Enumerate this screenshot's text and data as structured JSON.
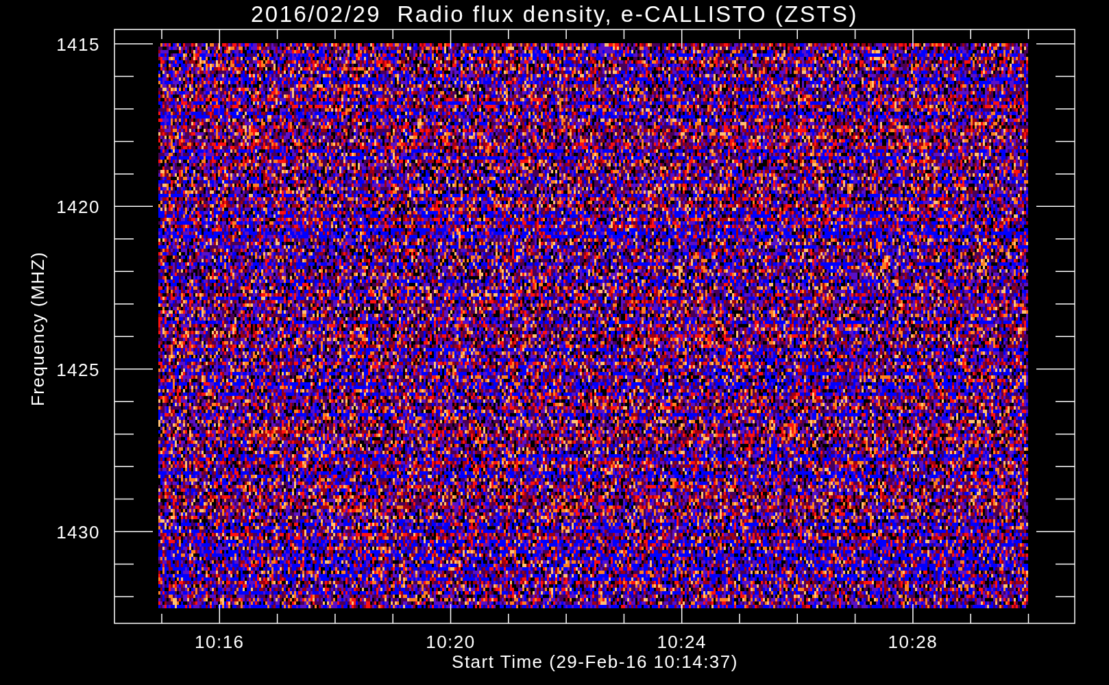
{
  "title": "2016/02/29  Radio flux density, e-CALLISTO (ZSTS)",
  "y_axis": {
    "label": "Frequency (MHZ)",
    "ticks": [
      "1415",
      "1420",
      "1425",
      "1430"
    ]
  },
  "x_axis": {
    "label": "Start Time (29-Feb-16 10:14:37)",
    "ticks": [
      "10:16",
      "10:20",
      "10:24",
      "10:28"
    ]
  }
}
